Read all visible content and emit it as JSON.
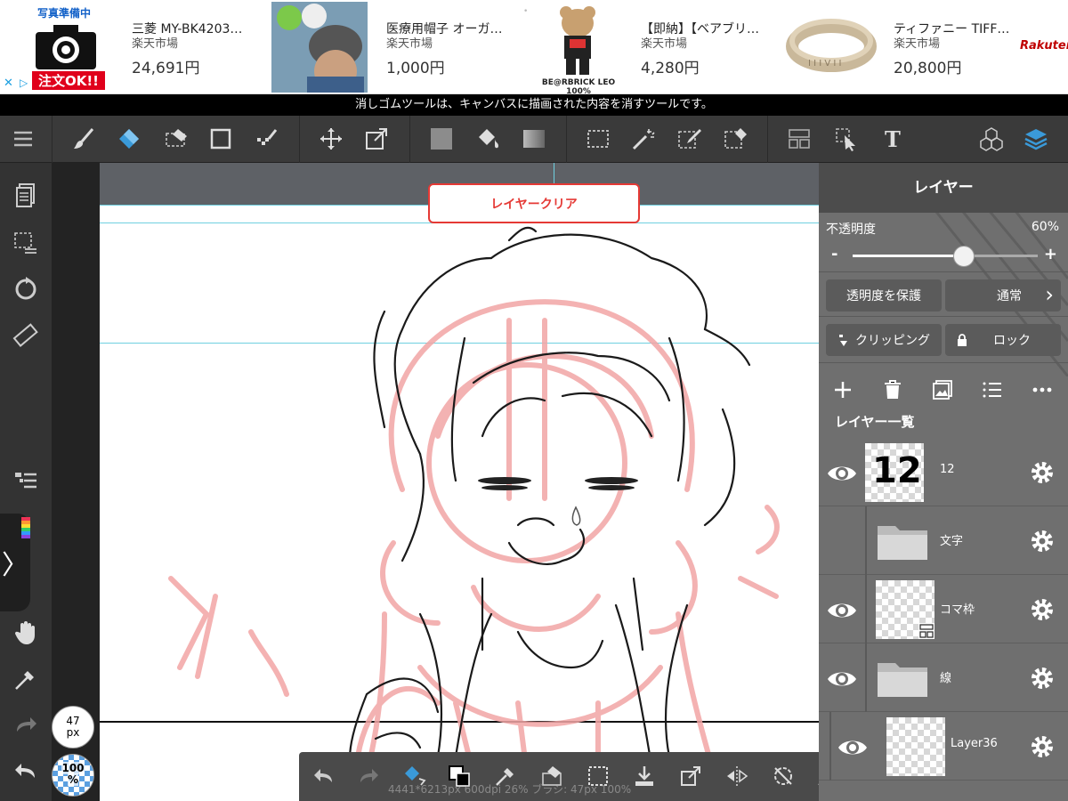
{
  "ad": {
    "items": [
      {
        "title": "三菱 MY-BK4203…",
        "shop": "楽天市場",
        "price": "24,691円",
        "thumb_top": "写真準備中",
        "thumb_bottom": "注文OK!!"
      },
      {
        "title": "医療用帽子 オーガ…",
        "shop": "楽天市場",
        "price": "1,000円"
      },
      {
        "title": "【即納】【ベアブリ…",
        "shop": "楽天市場",
        "price": "4,280円",
        "thumb_caption": "BE@RBRICK LEO 100%"
      },
      {
        "title": "ティファニー TIFF…",
        "shop": "楽天市場",
        "price": "20,800円"
      }
    ],
    "brand": "Rakuten",
    "close_glyph": "✕",
    "info_glyph": "▷",
    "dots": "• • •"
  },
  "hint": "消しゴムツールは、キャンバスに描画された内容を消すツールです。",
  "canvas": {
    "clear_button": "レイヤークリア",
    "status": "4441*6213px 600dpi 26% ブラシ: 47px 100%"
  },
  "left_sidebar": {
    "brush_size": "47\npx",
    "brush_opacity": "100\n%",
    "expand_glyph": "〉"
  },
  "layer_panel": {
    "title": "レイヤー",
    "opacity_label": "不透明度",
    "opacity_value": "60%",
    "opacity_fraction": 0.6,
    "minus": "-",
    "plus": "+",
    "protect_alpha": "透明度を保護",
    "blend_mode": "通常",
    "blend_chevron": "›",
    "clipping": "クリッピング",
    "lock": "ロック",
    "list_title": "レイヤー一覧",
    "layers": [
      {
        "name": "12",
        "thumb_text": "12",
        "visible": true,
        "kind": "layer"
      },
      {
        "name": "文字",
        "visible": false,
        "kind": "folder"
      },
      {
        "name": "コマ枠",
        "visible": true,
        "kind": "layer"
      },
      {
        "name": "線",
        "visible": true,
        "kind": "folder"
      },
      {
        "name": "Layer36",
        "visible": true,
        "kind": "layer"
      }
    ]
  },
  "colors": {
    "accent": "#3a9ad9",
    "clear_red": "#e53935",
    "sketch_pink": "#f2a5a5",
    "guide_cyan": "#6fd0e0"
  }
}
